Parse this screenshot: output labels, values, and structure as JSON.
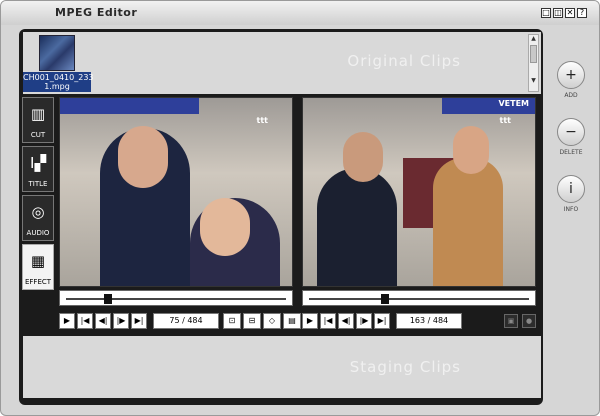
{
  "window": {
    "title": "MPEG Editor",
    "controls": [
      "□",
      "◫",
      "✕",
      "?"
    ]
  },
  "original_clips": {
    "caption": "Original Clips",
    "clip": {
      "name_line1": "CH001_0410_233",
      "name_line2": "1.mpg"
    }
  },
  "staging": {
    "caption": "Staging Clips"
  },
  "tools": [
    {
      "label": "CUT",
      "icon": "scissors-grid-icon",
      "glyph": "▥"
    },
    {
      "label": "TITLE",
      "icon": "title-icon",
      "glyph": "I▞"
    },
    {
      "label": "AUDIO",
      "icon": "audio-disc-icon",
      "glyph": "◎"
    },
    {
      "label": "EFFECT",
      "icon": "effect-grid-icon",
      "glyph": "▦"
    }
  ],
  "left_player": {
    "watermark": "ttt",
    "position_fraction": 0.18,
    "counter": "75 / 484",
    "buttons": [
      "▶",
      "|◀",
      "◀|",
      "|▶",
      "▶|"
    ],
    "tool_buttons": [
      "⊡",
      "⊟",
      "◇",
      "▤"
    ]
  },
  "right_player": {
    "watermark": "ttt",
    "sign": "VETEM",
    "position_fraction": 0.34,
    "counter": "163 / 484",
    "buttons": [
      "▶",
      "|◀",
      "◀|",
      "|▶",
      "▶|"
    ]
  },
  "side_actions": [
    {
      "label": "ADD",
      "glyph": "+"
    },
    {
      "label": "DELETE",
      "glyph": "−"
    },
    {
      "label": "INFO",
      "glyph": "i"
    }
  ],
  "mini_buttons": [
    "▣",
    "●"
  ],
  "colors": {
    "accent": "#1f3e86",
    "frame": "#1b1b1b"
  }
}
